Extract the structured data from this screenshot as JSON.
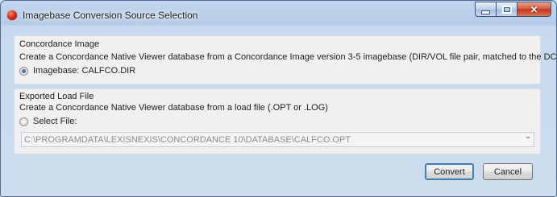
{
  "window": {
    "title": "Imagebase Conversion Source Selection",
    "icon": "app-red-sphere-icon"
  },
  "concordance_group": {
    "legend": "Concordance Image",
    "description": "Create a Concordance Native Viewer database from a Concordance Image version 3-5 imagebase (DIR/VOL file pair, matched to the DCB).",
    "radio_label": "Imagebase: CALFCO.DIR",
    "radio_selected": true
  },
  "loadfile_group": {
    "legend": "Exported Load File",
    "description": "Create a Concordance Native Viewer database from a load file (.OPT or .LOG)",
    "radio_label": "Select File:",
    "radio_selected": false,
    "file_path": "C:\\PROGRAMDATA\\LEXISNEXIS\\CONCORDANCE 10\\DATABASE\\CALFCO.OPT"
  },
  "buttons": {
    "convert": "Convert",
    "cancel": "Cancel"
  }
}
